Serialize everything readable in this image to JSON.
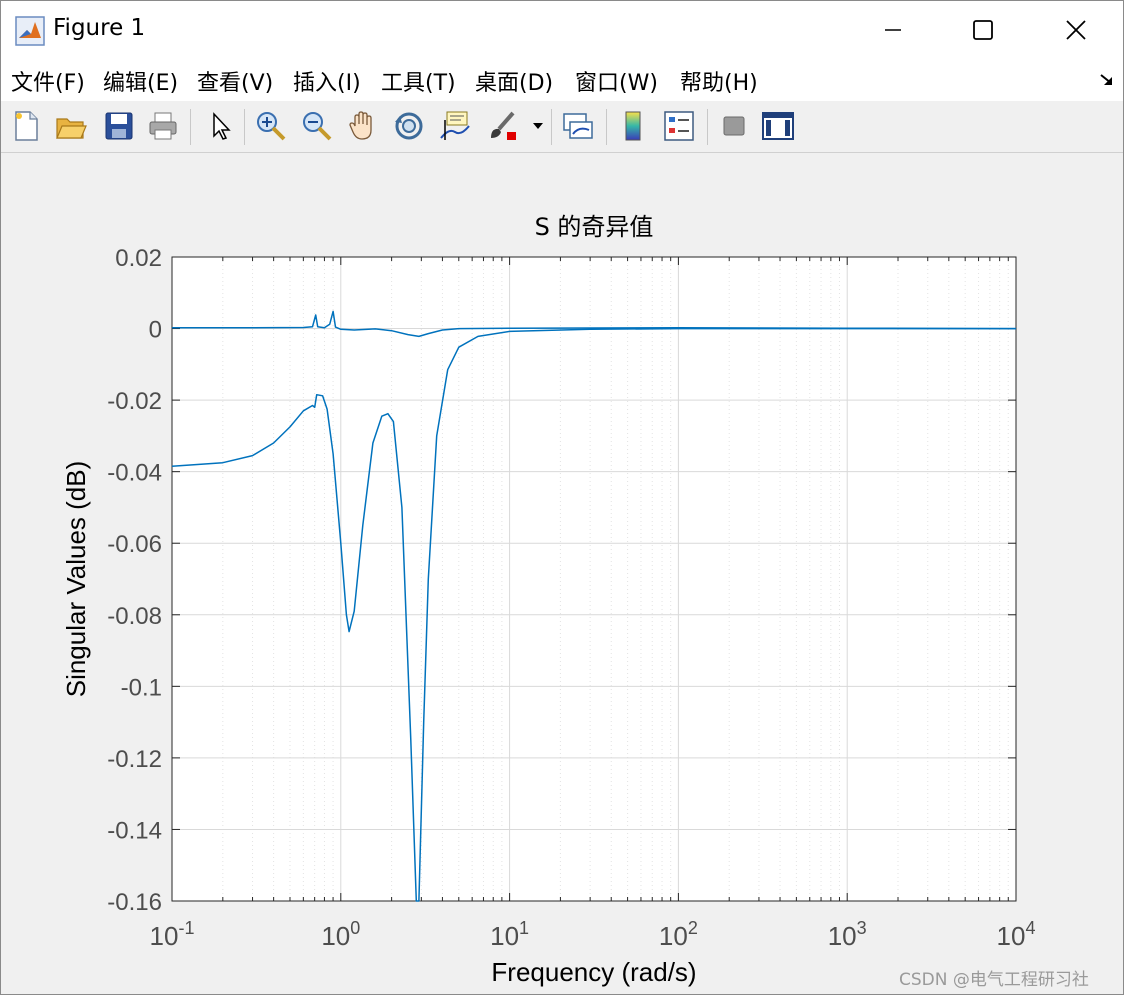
{
  "window": {
    "title": "Figure 1",
    "app_icon": "matlab-logo-icon",
    "controls": [
      "minimize-icon",
      "maximize-icon",
      "close-icon"
    ]
  },
  "menu": {
    "items": [
      {
        "label": "文件(F)"
      },
      {
        "label": "编辑(E)"
      },
      {
        "label": "查看(V)"
      },
      {
        "label": "插入(I)"
      },
      {
        "label": "工具(T)"
      },
      {
        "label": "桌面(D)"
      },
      {
        "label": "窗口(W)"
      },
      {
        "label": "帮助(H)"
      }
    ],
    "dock_icon": "dock-arrow-icon"
  },
  "toolbar": {
    "icons": [
      "new-figure-icon",
      "open-file-icon",
      "save-icon",
      "print-icon",
      "select-pointer-icon",
      "zoom-in-icon",
      "zoom-out-icon",
      "pan-hand-icon",
      "rotate-3d-icon",
      "data-cursor-icon",
      "brush-icon",
      "brush-dropdown-icon",
      "link-plot-icon",
      "colorbar-icon",
      "legend-icon",
      "hide-plot-tools-icon",
      "show-plot-tools-icon"
    ]
  },
  "watermark": "CSDN @电气工程研习社",
  "colors": {
    "line": "#0072bd",
    "grid": "#d9d9d9",
    "axes": "#262626",
    "tick_text": "#4d4d4d"
  },
  "chart_data": {
    "type": "line",
    "title": "S 的奇异值",
    "xlabel": "Frequency (rad/s)",
    "ylabel": "Singular Values (dB)",
    "xscale": "log",
    "xlim": [
      0.1,
      10000
    ],
    "ylim": [
      -0.16,
      0.02
    ],
    "grid": true,
    "xticks": [
      {
        "base": "10",
        "exp": "-1",
        "value": 0.1
      },
      {
        "base": "10",
        "exp": "0",
        "value": 1
      },
      {
        "base": "10",
        "exp": "1",
        "value": 10
      },
      {
        "base": "10",
        "exp": "2",
        "value": 100
      },
      {
        "base": "10",
        "exp": "3",
        "value": 1000
      },
      {
        "base": "10",
        "exp": "4",
        "value": 10000
      }
    ],
    "yticks": [
      {
        "label": "0.02",
        "value": 0.02
      },
      {
        "label": "0",
        "value": 0
      },
      {
        "label": "-0.02",
        "value": -0.02
      },
      {
        "label": "-0.04",
        "value": -0.04
      },
      {
        "label": "-0.06",
        "value": -0.06
      },
      {
        "label": "-0.08",
        "value": -0.08
      },
      {
        "label": "-0.1",
        "value": -0.1
      },
      {
        "label": "-0.12",
        "value": -0.12
      },
      {
        "label": "-0.14",
        "value": -0.14
      },
      {
        "label": "-0.16",
        "value": -0.16
      }
    ],
    "series": [
      {
        "points": [
          [
            0.1,
            0.0002
          ],
          [
            0.3,
            0.0002
          ],
          [
            0.6,
            0.0003
          ],
          [
            0.68,
            0.0005
          ],
          [
            0.71,
            0.0038
          ],
          [
            0.73,
            0.0005
          ],
          [
            0.8,
            0.0002
          ],
          [
            0.86,
            0.0012
          ],
          [
            0.9,
            0.0048
          ],
          [
            0.93,
            0.0004
          ],
          [
            1.0,
            -0.0002
          ],
          [
            1.2,
            -0.0004
          ],
          [
            1.6,
            -0.0001
          ],
          [
            2.0,
            -0.0006
          ],
          [
            2.5,
            -0.0017
          ],
          [
            2.9,
            -0.0022
          ],
          [
            3.3,
            -0.0014
          ],
          [
            4.0,
            -0.0004
          ],
          [
            5.0,
            0.0
          ],
          [
            10,
            0.0001
          ],
          [
            100,
            0.0002
          ],
          [
            1000,
            0.0001
          ],
          [
            10000,
            0.0
          ]
        ]
      },
      {
        "points": [
          [
            0.1,
            -0.0385
          ],
          [
            0.2,
            -0.0375
          ],
          [
            0.3,
            -0.0355
          ],
          [
            0.4,
            -0.032
          ],
          [
            0.5,
            -0.0275
          ],
          [
            0.6,
            -0.023
          ],
          [
            0.68,
            -0.0215
          ],
          [
            0.7,
            -0.022
          ],
          [
            0.72,
            -0.0185
          ],
          [
            0.78,
            -0.0188
          ],
          [
            0.83,
            -0.0225
          ],
          [
            0.9,
            -0.035
          ],
          [
            1.0,
            -0.06
          ],
          [
            1.08,
            -0.08
          ],
          [
            1.12,
            -0.0847
          ],
          [
            1.2,
            -0.079
          ],
          [
            1.35,
            -0.055
          ],
          [
            1.55,
            -0.032
          ],
          [
            1.75,
            -0.0245
          ],
          [
            1.9,
            -0.0238
          ],
          [
            2.05,
            -0.026
          ],
          [
            2.3,
            -0.05
          ],
          [
            2.6,
            -0.115
          ],
          [
            2.8,
            -0.16
          ],
          [
            2.9,
            -0.16
          ],
          [
            3.1,
            -0.11
          ],
          [
            3.3,
            -0.07
          ],
          [
            3.7,
            -0.03
          ],
          [
            4.3,
            -0.0115
          ],
          [
            5.0,
            -0.0052
          ],
          [
            6.5,
            -0.0022
          ],
          [
            10,
            -0.0008
          ],
          [
            30,
            -0.0002
          ],
          [
            100,
            0.0
          ],
          [
            10000,
            0.0
          ]
        ]
      }
    ]
  }
}
